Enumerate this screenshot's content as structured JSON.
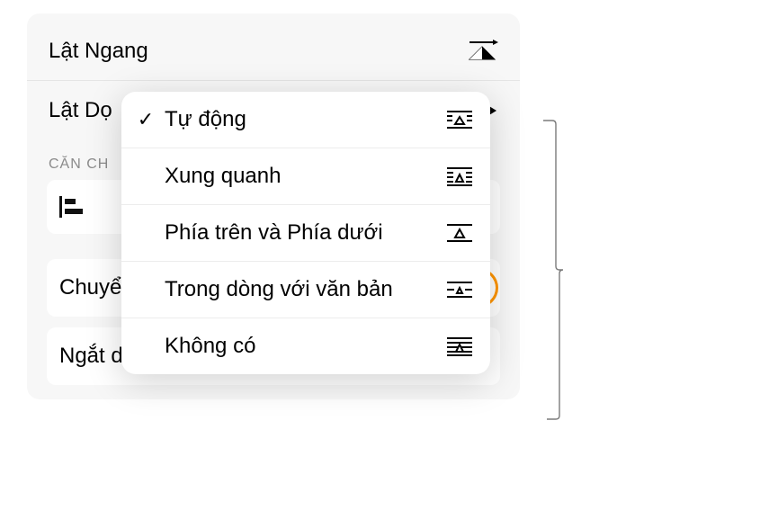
{
  "panel": {
    "flip_horizontal": "Lật Ngang",
    "flip_vertical": "Lật Dọ",
    "section_align": "CĂN CH",
    "move_truncated": "Chuyể",
    "wrap_label": "Ngắt dòng Văn bản",
    "wrap_value": "Tự động"
  },
  "popup": {
    "items": [
      {
        "label": "Tự động",
        "checked": true
      },
      {
        "label": "Xung quanh",
        "checked": false
      },
      {
        "label": "Phía trên và Phía dưới",
        "checked": false
      },
      {
        "label": "Trong dòng với văn bản",
        "checked": false
      },
      {
        "label": "Không có",
        "checked": false
      }
    ]
  }
}
